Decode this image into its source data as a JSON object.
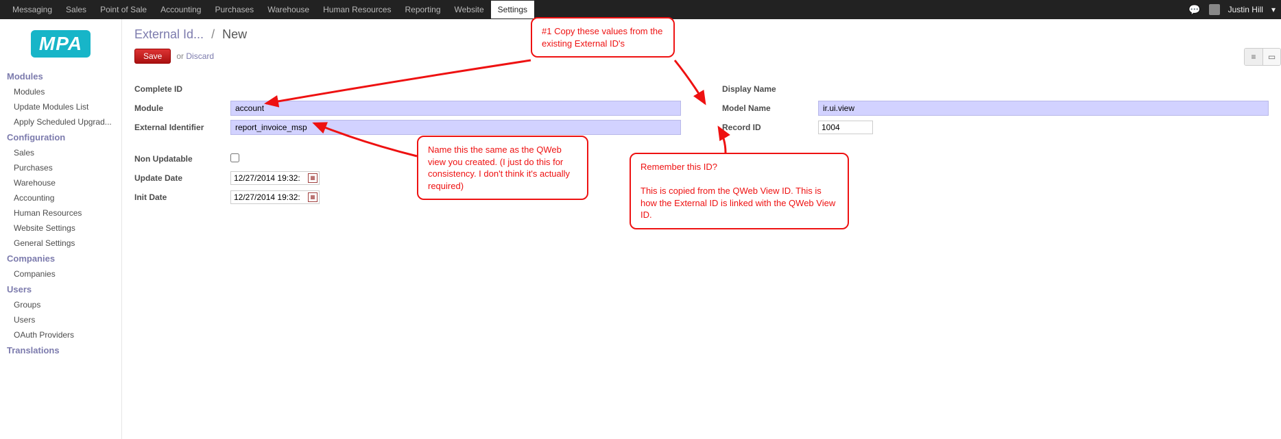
{
  "topnav": {
    "items": [
      "Messaging",
      "Sales",
      "Point of Sale",
      "Accounting",
      "Purchases",
      "Warehouse",
      "Human Resources",
      "Reporting",
      "Website",
      "Settings"
    ],
    "active": "Settings"
  },
  "topright": {
    "user": "Justin Hill",
    "caret": "▾"
  },
  "logo_text": "MPA",
  "sidebar": {
    "sections": [
      {
        "title": "Modules",
        "items": [
          "Modules",
          "Update Modules List",
          "Apply Scheduled Upgrad..."
        ]
      },
      {
        "title": "Configuration",
        "items": [
          "Sales",
          "Purchases",
          "Warehouse",
          "Accounting",
          "Human Resources",
          "Website Settings",
          "General Settings"
        ]
      },
      {
        "title": "Companies",
        "items": [
          "Companies"
        ]
      },
      {
        "title": "Users",
        "items": [
          "Groups",
          "Users",
          "OAuth Providers"
        ]
      },
      {
        "title": "Translations",
        "items": []
      }
    ]
  },
  "breadcrumb": {
    "parent": "External Id...",
    "sep": "/",
    "current": "New"
  },
  "actions": {
    "save": "Save",
    "or": "or",
    "discard": "Discard"
  },
  "form": {
    "left": {
      "complete_id_label": "Complete ID",
      "module_label": "Module",
      "module_value": "account",
      "ext_id_label": "External Identifier",
      "ext_id_value": "report_invoice_msp",
      "non_updatable_label": "Non Updatable",
      "non_updatable_checked": false,
      "update_date_label": "Update Date",
      "update_date_value": "12/27/2014 19:32:",
      "init_date_label": "Init Date",
      "init_date_value": "12/27/2014 19:32:"
    },
    "right": {
      "display_name_label": "Display Name",
      "model_name_label": "Model Name",
      "model_name_value": "ir.ui.view",
      "record_id_label": "Record ID",
      "record_id_value": "1004"
    }
  },
  "annotations": {
    "a1": "#1 Copy these values from the existing External ID's",
    "a2": "Name this the same as the QWeb view you created. (I just do this for consistency. I don't think it's actually required)",
    "a3": "Remember this ID?\n\nThis is copied from the QWeb View ID. This is how the External ID is linked with the QWeb View ID."
  }
}
